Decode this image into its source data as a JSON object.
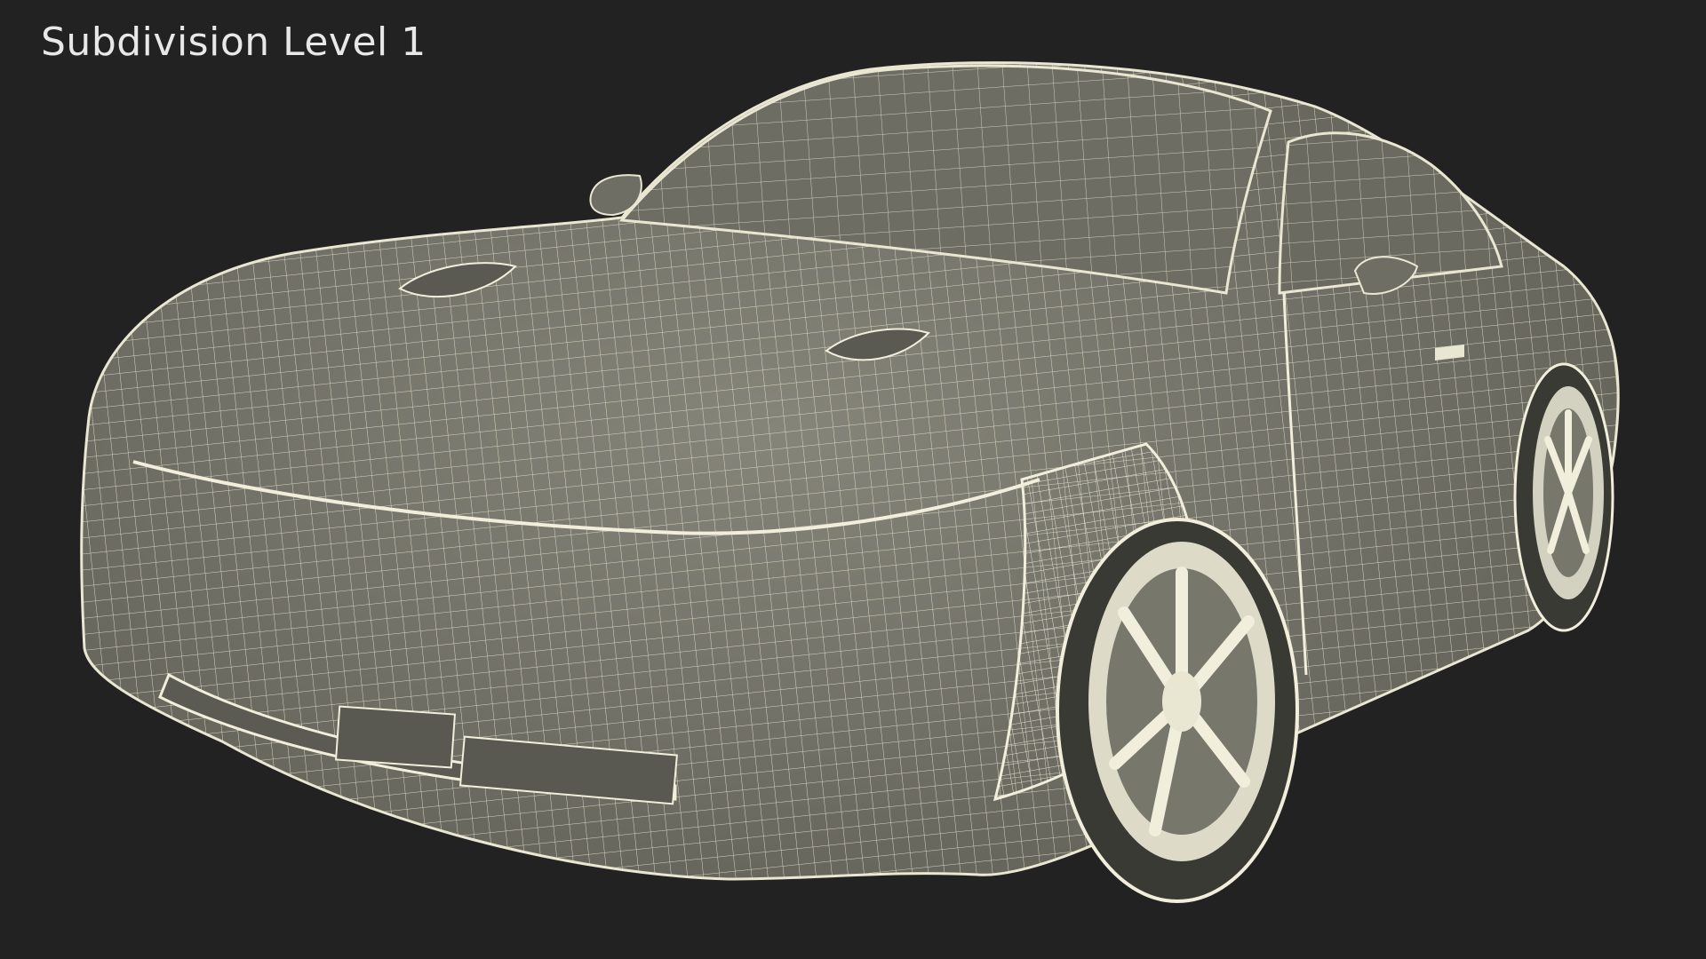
{
  "viewport": {
    "label": "Subdivision Level 1",
    "background_color": "#222222",
    "label_color": "#e8e8e8"
  },
  "model": {
    "subject": "car-wireframe",
    "surface_color": "#77776b",
    "wire_color": "#e9e6d2"
  }
}
